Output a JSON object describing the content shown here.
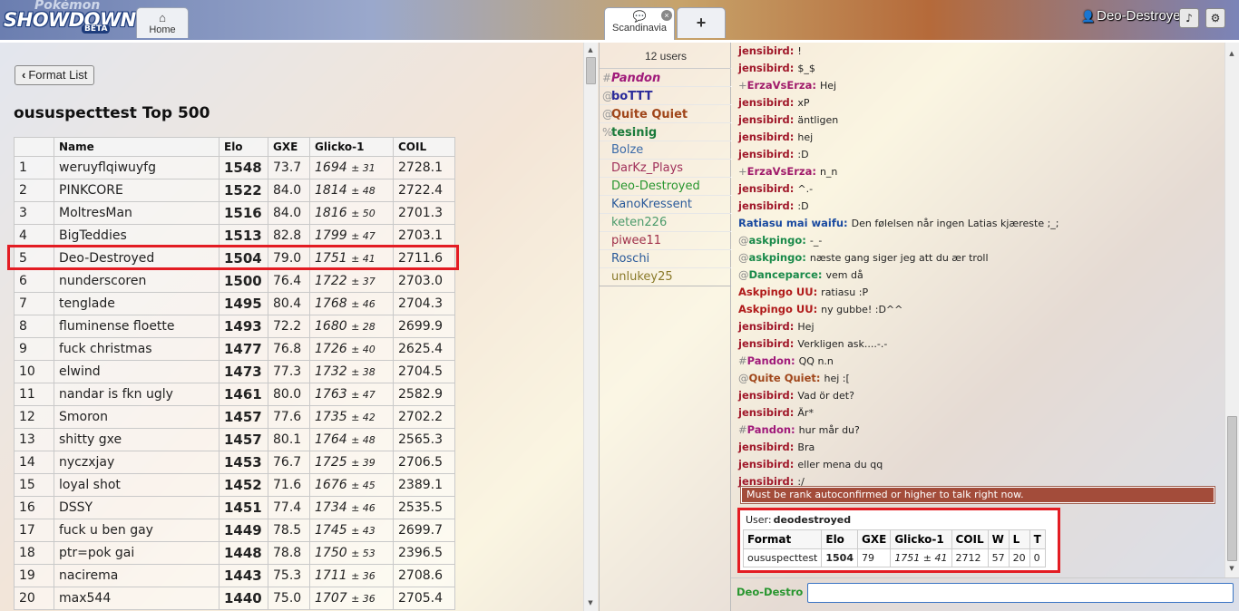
{
  "header": {
    "logo_top": "Pokémon",
    "logo_main": "SHOWDOWN",
    "logo_badge": "BETA",
    "home_label": "Home",
    "room_label": "Scandinavia",
    "close_glyph": "×",
    "plus_label": "+",
    "username": "Deo-Destroyed",
    "sound_icon": "♪",
    "options_icon": "⚙"
  },
  "ladder": {
    "format_button": "Format List",
    "title": "oususpecttest Top 500",
    "columns": [
      "",
      "Name",
      "Elo",
      "GXE",
      "Glicko-1",
      "COIL"
    ],
    "rows": [
      {
        "rank": "1",
        "name": "weruyflqiwuyfg",
        "elo": "1548",
        "gxe": "73.7",
        "glicko": "1694",
        "dev": "± 31",
        "coil": "2728.1"
      },
      {
        "rank": "2",
        "name": "PINKCORE",
        "elo": "1522",
        "gxe": "84.0",
        "glicko": "1814",
        "dev": "± 48",
        "coil": "2722.4"
      },
      {
        "rank": "3",
        "name": "MoltresMan",
        "elo": "1516",
        "gxe": "84.0",
        "glicko": "1816",
        "dev": "± 50",
        "coil": "2701.3"
      },
      {
        "rank": "4",
        "name": "BigTeddies",
        "elo": "1513",
        "gxe": "82.8",
        "glicko": "1799",
        "dev": "± 47",
        "coil": "2703.1"
      },
      {
        "rank": "5",
        "name": "Deo-Destroyed",
        "elo": "1504",
        "gxe": "79.0",
        "glicko": "1751",
        "dev": "± 41",
        "coil": "2711.6"
      },
      {
        "rank": "6",
        "name": "nunderscoren",
        "elo": "1500",
        "gxe": "76.4",
        "glicko": "1722",
        "dev": "± 37",
        "coil": "2703.0"
      },
      {
        "rank": "7",
        "name": "tenglade",
        "elo": "1495",
        "gxe": "80.4",
        "glicko": "1768",
        "dev": "± 46",
        "coil": "2704.3"
      },
      {
        "rank": "8",
        "name": "fluminense floette",
        "elo": "1493",
        "gxe": "72.2",
        "glicko": "1680",
        "dev": "± 28",
        "coil": "2699.9"
      },
      {
        "rank": "9",
        "name": "fuck christmas",
        "elo": "1477",
        "gxe": "76.8",
        "glicko": "1726",
        "dev": "± 40",
        "coil": "2625.4"
      },
      {
        "rank": "10",
        "name": "elwind",
        "elo": "1473",
        "gxe": "77.3",
        "glicko": "1732",
        "dev": "± 38",
        "coil": "2704.5"
      },
      {
        "rank": "11",
        "name": "nandar is fkn ugly",
        "elo": "1461",
        "gxe": "80.0",
        "glicko": "1763",
        "dev": "± 47",
        "coil": "2582.9"
      },
      {
        "rank": "12",
        "name": "Smoron",
        "elo": "1457",
        "gxe": "77.6",
        "glicko": "1735",
        "dev": "± 42",
        "coil": "2702.2"
      },
      {
        "rank": "13",
        "name": "shitty gxe",
        "elo": "1457",
        "gxe": "80.1",
        "glicko": "1764",
        "dev": "± 48",
        "coil": "2565.3"
      },
      {
        "rank": "14",
        "name": "nyczxjay",
        "elo": "1453",
        "gxe": "76.7",
        "glicko": "1725",
        "dev": "± 39",
        "coil": "2706.5"
      },
      {
        "rank": "15",
        "name": "loyal shot",
        "elo": "1452",
        "gxe": "71.6",
        "glicko": "1676",
        "dev": "± 45",
        "coil": "2389.1"
      },
      {
        "rank": "16",
        "name": "DSSY",
        "elo": "1451",
        "gxe": "77.4",
        "glicko": "1734",
        "dev": "± 46",
        "coil": "2535.5"
      },
      {
        "rank": "17",
        "name": "fuck u ben gay",
        "elo": "1449",
        "gxe": "78.5",
        "glicko": "1745",
        "dev": "± 43",
        "coil": "2699.7"
      },
      {
        "rank": "18",
        "name": "ptr=pok gai",
        "elo": "1448",
        "gxe": "78.8",
        "glicko": "1750",
        "dev": "± 53",
        "coil": "2396.5"
      },
      {
        "rank": "19",
        "name": "nacirema",
        "elo": "1443",
        "gxe": "75.3",
        "glicko": "1711",
        "dev": "± 36",
        "coil": "2708.6"
      },
      {
        "rank": "20",
        "name": "max544",
        "elo": "1440",
        "gxe": "75.0",
        "glicko": "1707",
        "dev": "± 36",
        "coil": "2705.4"
      }
    ]
  },
  "userlist": {
    "count": "12 users",
    "users": [
      {
        "rank": "#",
        "name": "Pandon",
        "color": "#a01a7a",
        "bold": true,
        "italic": true
      },
      {
        "rank": "@",
        "name": "boTTT",
        "color": "#2a2a9a",
        "bold": true,
        "italic": false
      },
      {
        "rank": "@",
        "name": "Quite Quiet",
        "color": "#a0461a",
        "bold": true,
        "italic": false
      },
      {
        "rank": "%",
        "name": "tesinig",
        "color": "#1a7a3a",
        "bold": true,
        "italic": false
      },
      {
        "rank": "",
        "name": "Bolze",
        "color": "#3a6aa8",
        "bold": false,
        "italic": false
      },
      {
        "rank": "",
        "name": "DarKz_Plays",
        "color": "#a0305a",
        "bold": false,
        "italic": false
      },
      {
        "rank": "",
        "name": "Deo-Destroyed",
        "color": "#28962f",
        "bold": false,
        "italic": false
      },
      {
        "rank": "",
        "name": "KanoKressent",
        "color": "#2a5a9a",
        "bold": false,
        "italic": false
      },
      {
        "rank": "",
        "name": "keten226",
        "color": "#4a9a6a",
        "bold": false,
        "italic": false
      },
      {
        "rank": "",
        "name": "piwee11",
        "color": "#a0304a",
        "bold": false,
        "italic": false
      },
      {
        "rank": "",
        "name": "Roschi",
        "color": "#2a5a9a",
        "bold": false,
        "italic": false
      },
      {
        "rank": "",
        "name": "unlukey25",
        "color": "#8a7a2a",
        "bold": false,
        "italic": false
      }
    ]
  },
  "chat": {
    "lines": [
      {
        "group": "",
        "user": "jensibird:",
        "color": "#a0182a",
        "msg": "!"
      },
      {
        "group": "",
        "user": "jensibird:",
        "color": "#a0182a",
        "msg": "$_$"
      },
      {
        "group": "+",
        "user": "ErzaVsErza:",
        "color": "#a01a6a",
        "msg": "Hej"
      },
      {
        "group": "",
        "user": "jensibird:",
        "color": "#a0182a",
        "msg": "xP"
      },
      {
        "group": "",
        "user": "jensibird:",
        "color": "#a0182a",
        "msg": "äntligen"
      },
      {
        "group": "",
        "user": "jensibird:",
        "color": "#a0182a",
        "msg": "hej"
      },
      {
        "group": "",
        "user": "jensibird:",
        "color": "#a0182a",
        "msg": ":D"
      },
      {
        "group": "+",
        "user": "ErzaVsErza:",
        "color": "#a01a6a",
        "msg": "n_n"
      },
      {
        "group": "",
        "user": "jensibird:",
        "color": "#a0182a",
        "msg": "^.-"
      },
      {
        "group": "",
        "user": "jensibird:",
        "color": "#a0182a",
        "msg": ":D"
      },
      {
        "group": "",
        "user": "Ratiasu mai waifu:",
        "color": "#1a4aa0",
        "msg": "Den følelsen når ingen Latias kjæreste ;_;"
      },
      {
        "group": "@",
        "user": "askpingo:",
        "color": "#1a8a4a",
        "msg": "-_-"
      },
      {
        "group": "@",
        "user": "askpingo:",
        "color": "#1a8a4a",
        "msg": "næste gang siger jeg att du ær troll"
      },
      {
        "group": "@",
        "user": "Danceparce:",
        "color": "#1a8a4a",
        "msg": "vem då"
      },
      {
        "group": "",
        "user": "Askpingo UU:",
        "color": "#b01a1a",
        "msg": "ratiasu :P"
      },
      {
        "group": "",
        "user": "Askpingo UU:",
        "color": "#b01a1a",
        "msg": "ny gubbe! :D^^"
      },
      {
        "group": "",
        "user": "jensibird:",
        "color": "#a0182a",
        "msg": "Hej"
      },
      {
        "group": "",
        "user": "jensibird:",
        "color": "#a0182a",
        "msg": "Verkligen ask....-.-"
      },
      {
        "group": "#",
        "user": "Pandon:",
        "color": "#a01a7a",
        "msg": "QQ n.n"
      },
      {
        "group": "@",
        "user": "Quite Quiet:",
        "color": "#a0461a",
        "msg": "hej :["
      },
      {
        "group": "",
        "user": "jensibird:",
        "color": "#a0182a",
        "msg": "Vad ör det?"
      },
      {
        "group": "",
        "user": "jensibird:",
        "color": "#a0182a",
        "msg": "Är*"
      },
      {
        "group": "#",
        "user": "Pandon:",
        "color": "#a01a7a",
        "msg": "hur mår du?"
      },
      {
        "group": "",
        "user": "jensibird:",
        "color": "#a0182a",
        "msg": "Bra"
      },
      {
        "group": "",
        "user": "jensibird:",
        "color": "#a0182a",
        "msg": "eller mena du qq"
      },
      {
        "group": "",
        "user": "jensibird:",
        "color": "#a0182a",
        "msg": ":/"
      }
    ],
    "error": "Must be rank autoconfirmed or higher to talk right now.",
    "rank_card": {
      "user_label": "User:",
      "user": "deodestroyed",
      "headers": [
        "Format",
        "Elo",
        "GXE",
        "Glicko-1",
        "COIL",
        "W",
        "L",
        "T"
      ],
      "row": {
        "format": "oususpecttest",
        "elo": "1504",
        "gxe": "79",
        "glicko": "1751 ± 41",
        "coil": "2712",
        "w": "57",
        "l": "20",
        "t": "0"
      }
    },
    "input_name": "Deo-Destro",
    "input_value": ""
  },
  "colors": {
    "highlight": "#e31c23",
    "error_bg": "#a34c3a",
    "self_user": "#28962f"
  }
}
